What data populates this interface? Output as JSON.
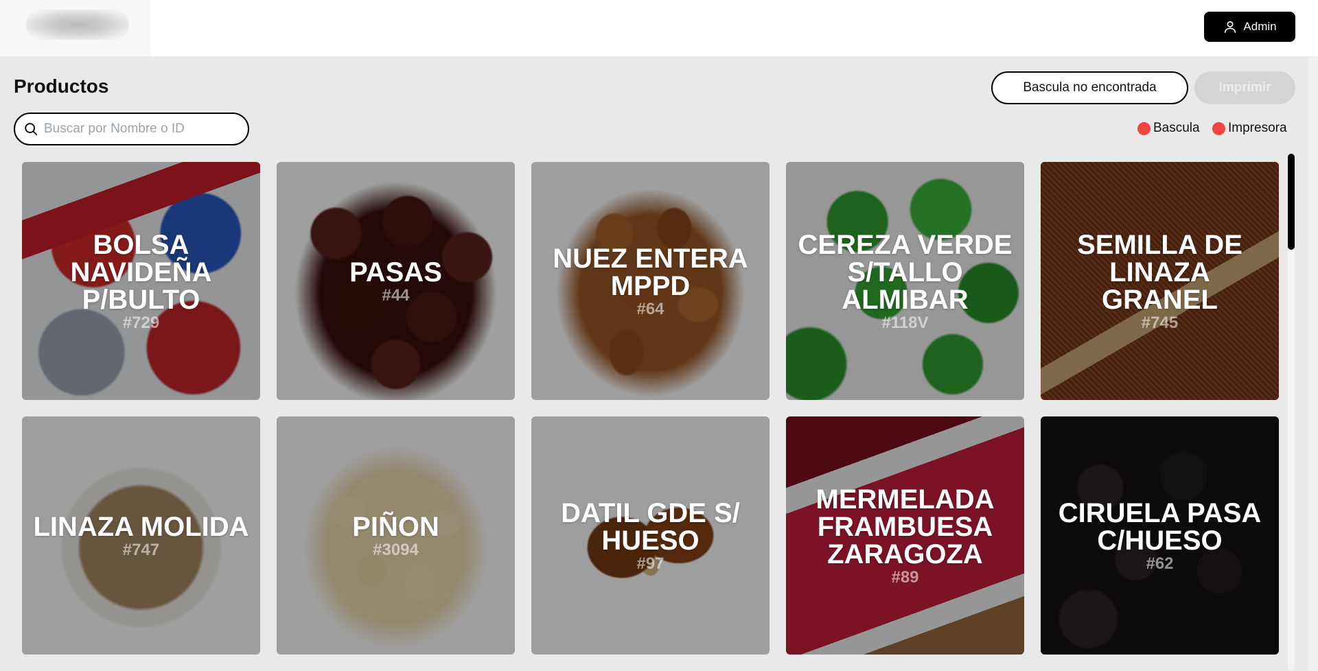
{
  "header": {
    "admin_label": "Admin"
  },
  "page": {
    "title": "Productos"
  },
  "toolbar": {
    "scale_button": "Bascula no encontrada",
    "print_button": "Imprimir"
  },
  "search": {
    "placeholder": "Buscar por Nombre o ID",
    "value": ""
  },
  "status": {
    "bascula": "Bascula",
    "impresora": "Impresora",
    "color": "#ef4444"
  },
  "products": [
    {
      "name": "BOLSA NAVIDEÑA P/BULTO",
      "id": "#729",
      "image": "christmas-bags"
    },
    {
      "name": "PASAS",
      "id": "#44",
      "image": "raisins"
    },
    {
      "name": "NUEZ ENTERA MPPD",
      "id": "#64",
      "image": "pecans"
    },
    {
      "name": "CEREZA VERDE S/TALLO ALMIBAR",
      "id": "#118V",
      "image": "green-cherries"
    },
    {
      "name": "SEMILLA DE LINAZA GRANEL",
      "id": "#745",
      "image": "flax-seeds"
    },
    {
      "name": "LINAZA MOLIDA",
      "id": "#747",
      "image": "ground-flax"
    },
    {
      "name": "PIÑON",
      "id": "#3094",
      "image": "pine-nuts"
    },
    {
      "name": "DATIL GDE S/ HUESO",
      "id": "#97",
      "image": "dates"
    },
    {
      "name": "MERMELADA FRAMBUESA ZARAGOZA",
      "id": "#89",
      "image": "raspberry-jam"
    },
    {
      "name": "CIRUELA PASA C/HUESO",
      "id": "#62",
      "image": "prunes"
    }
  ]
}
